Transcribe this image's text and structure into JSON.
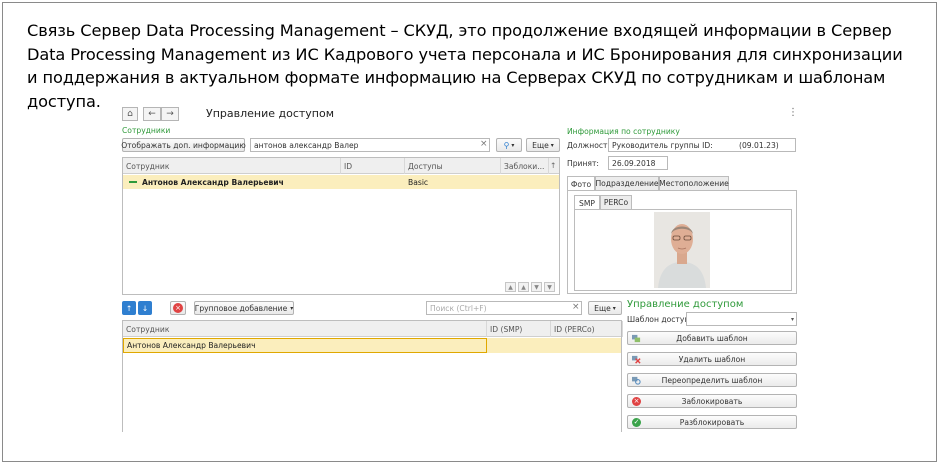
{
  "intro_text": "Связь Сервер Data Processing Management  – СКУД, это продолжение входящей информации в Сервер Data Processing Management  из ИС Кадрового учета персонала и ИС Бронирования для синхронизации и поддержания в актуальном формате информацию на Серверах СКУД по сотрудникам и шаблонам доступа.",
  "window": {
    "title": "Управление доступом",
    "menu_glyph": "⋮"
  },
  "employees": {
    "section_label": "Сотрудники",
    "show_info_button": "Отображать доп. информацию",
    "search_value": "антонов александр Валер",
    "clear_glyph": "×",
    "more_button": "Еще",
    "columns": [
      "Сотрудник",
      "ID",
      "Доступы",
      "Заблоки..."
    ],
    "rows": [
      {
        "name": "Антонов Александр Валерьевич",
        "id": "",
        "access": "Basic",
        "blocked": ""
      }
    ]
  },
  "group": {
    "group_add_button": "Групповое добавление",
    "search_placeholder": "Поиск (Ctrl+F)",
    "more_button": "Еще",
    "columns": [
      "Сотрудник",
      "ID (SMP)",
      "ID (PERCo)"
    ],
    "rows": [
      {
        "name": "Антонов Александр Валерьевич",
        "smp": "",
        "perco": ""
      }
    ]
  },
  "info": {
    "section_label": "Информация по сотруднику",
    "position_label": "Должность:",
    "position_value": "Руководитель группы ID:",
    "position_code": "(09.01.23)",
    "hired_label": "Принят:",
    "hired_value": "26.09.2018",
    "tabs": [
      "Фото",
      "Подразделение",
      "Местоположение"
    ],
    "subtabs": [
      "SMP",
      "PERCo"
    ]
  },
  "access": {
    "title": "Управление доступом",
    "template_label": "Шаблон доступа:",
    "template_value": "",
    "buttons": [
      "Добавить шаблон",
      "Удалить шаблон",
      "Переопределить шаблон",
      "Заблокировать",
      "Разблокировать"
    ]
  },
  "colors": {
    "accent_green": "#2f9a3a",
    "row_highlight": "#fbeebd",
    "blue_arrow": "#2f7fd0",
    "red_icon": "#e04343"
  }
}
